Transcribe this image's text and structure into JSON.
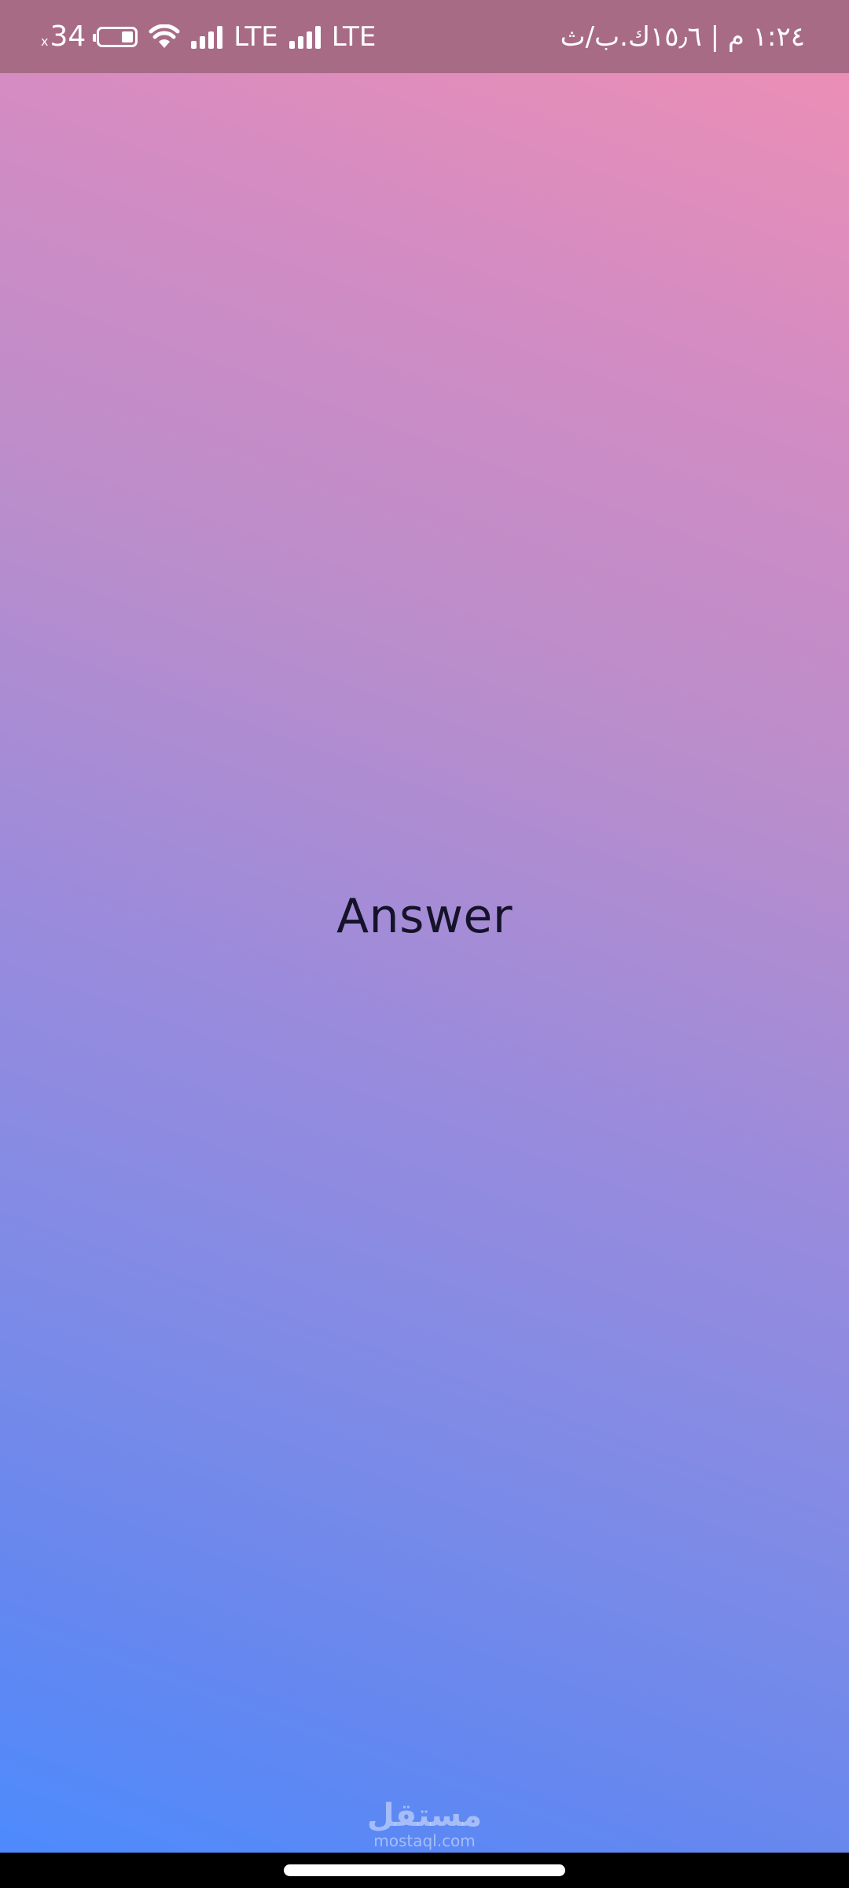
{
  "status_bar": {
    "battery_percent": "34",
    "battery_marker": "x",
    "network_1": "LTE",
    "network_2": "LTE",
    "time_and_speed": "١:٢٤ م | ١٥٫٦ك.ب/ث",
    "icons": [
      "battery-icon",
      "wifi-icon",
      "signal-icon",
      "signal-icon"
    ]
  },
  "main": {
    "answer_label": "Answer"
  },
  "watermark": {
    "arabic": "مستقل",
    "latin": "mostaql.com"
  },
  "colors": {
    "status_bar_bg": "#a86b86",
    "gradient_top": "#f08fb3",
    "gradient_bottom": "#4a8bff",
    "text": "#15132a"
  }
}
